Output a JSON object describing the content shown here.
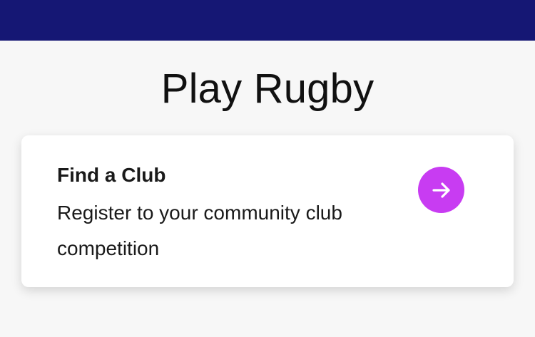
{
  "header": {
    "background_color": "#151774"
  },
  "page": {
    "title": "Play Rugby"
  },
  "card": {
    "title": "Find a Club",
    "description": "Register to your community club competition",
    "action_icon": "arrow-right-icon",
    "accent_color": "#c83cf2"
  }
}
